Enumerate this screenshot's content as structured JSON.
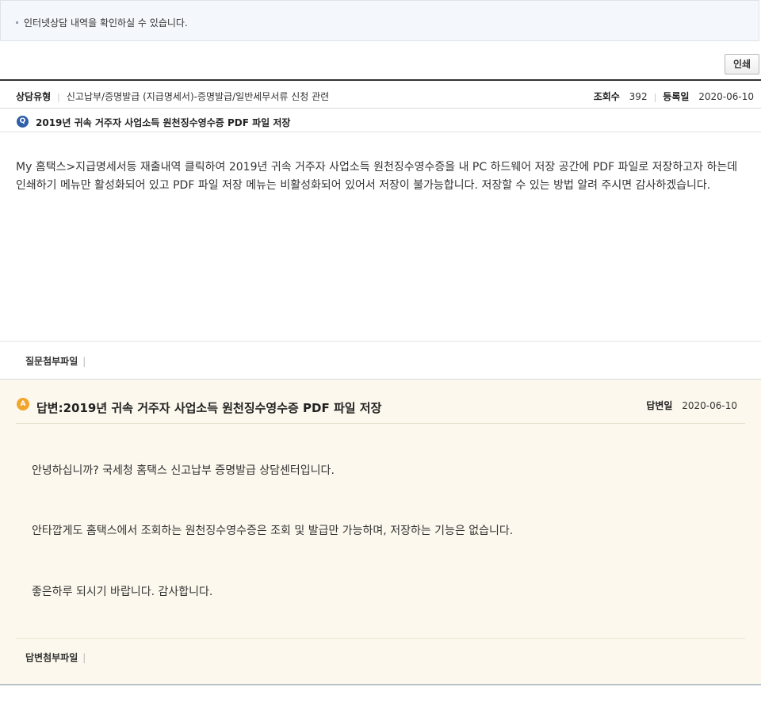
{
  "notice": {
    "text": "인터넷상담 내역을 확인하실 수 있습니다."
  },
  "toolbar": {
    "print_label": "인쇄"
  },
  "meta": {
    "type_label": "상담유형",
    "type_value": "신고납부/증명발급 (지급명세서)-증명발급/일반세무서류 신청 관련",
    "views_label": "조회수",
    "views_value": "392",
    "date_label": "등록일",
    "date_value": "2020-06-10"
  },
  "question": {
    "icon": "Q",
    "title": "2019년 귀속 거주자 사업소득 원천징수영수증 PDF 파일 저장",
    "body": "My 홈택스>지급명세서등 재출내역 클릭하여 2019년 귀속 거주자 사업소득 원천징수영수증을 내 PC 하드웨어 저장 공간에 PDF 파일로 저장하고자 하는데 인쇄하기 메뉴만 활성화되어 있고 PDF 파일 저장 메뉴는 비활성화되어 있어서 저장이 불가능합니다. 저장할 수 있는 방법 알려 주시면 감사하겠습니다.",
    "attach_label": "질문첨부파일"
  },
  "answer": {
    "icon": "A",
    "title": "답변:2019년 귀속 거주자 사업소득 원천징수영수증 PDF 파일 저장",
    "date_label": "답변일",
    "date_value": "2020-06-10",
    "lines": [
      "안녕하십니까? 국세청 홈택스 신고납부 증명발급 상담센터입니다.",
      "안타깝게도 홈택스에서 조회하는 원천징수영수증은 조회 및 발급만 가능하며, 저장하는 기능은 없습니다.",
      "좋은하루 되시기 바랍니다. 감사합니다."
    ],
    "attach_label": "답변첨부파일"
  },
  "colors": {
    "q_icon": "#2e5fa8",
    "a_icon": "#f2a52c",
    "answer_bg": "#fcf8ed"
  }
}
